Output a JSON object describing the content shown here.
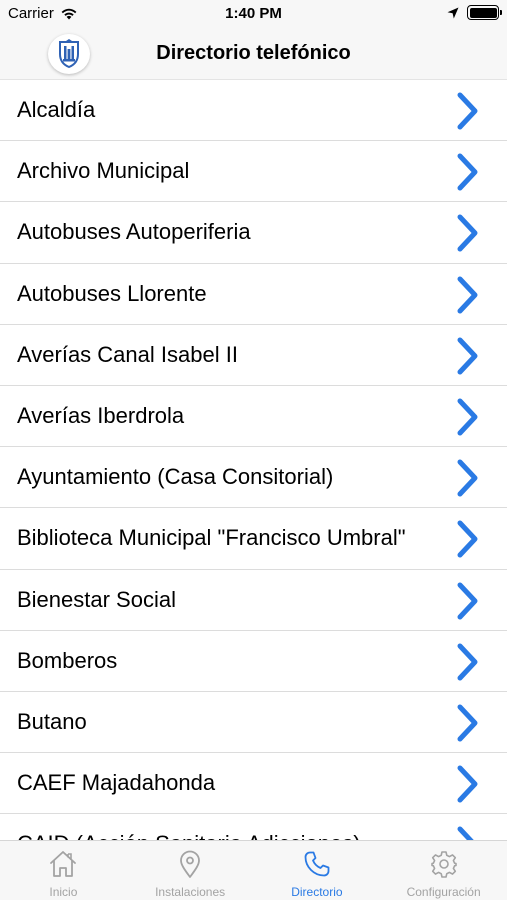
{
  "status_bar": {
    "carrier": "Carrier",
    "time": "1:40 PM"
  },
  "nav": {
    "title": "Directorio telefónico",
    "logo_icon": "municipal-coat-of-arms-icon"
  },
  "directory": {
    "items": [
      {
        "label": "Alcaldía"
      },
      {
        "label": "Archivo Municipal"
      },
      {
        "label": "Autobuses Autoperiferia"
      },
      {
        "label": "Autobuses Llorente"
      },
      {
        "label": "Averías Canal Isabel II"
      },
      {
        "label": "Averías Iberdrola"
      },
      {
        "label": "Ayuntamiento (Casa Consitorial)"
      },
      {
        "label": "Biblioteca Municipal \"Francisco Umbral\""
      },
      {
        "label": "Bienestar Social"
      },
      {
        "label": "Bomberos"
      },
      {
        "label": "Butano"
      },
      {
        "label": "CAEF Majadahonda"
      },
      {
        "label": "CAID (Acción Sanitaria Adicciones)"
      }
    ]
  },
  "tab_bar": {
    "tabs": [
      {
        "label": "Inicio",
        "icon": "home-icon"
      },
      {
        "label": "Instalaciones",
        "icon": "location-pin-icon"
      },
      {
        "label": "Directorio",
        "icon": "phone-icon",
        "active": true
      },
      {
        "label": "Configuración",
        "icon": "gear-icon"
      }
    ]
  },
  "colors": {
    "accent": "#2a7ae4",
    "inactive": "#a3a3a3",
    "bar_background": "#f7f7f7"
  }
}
